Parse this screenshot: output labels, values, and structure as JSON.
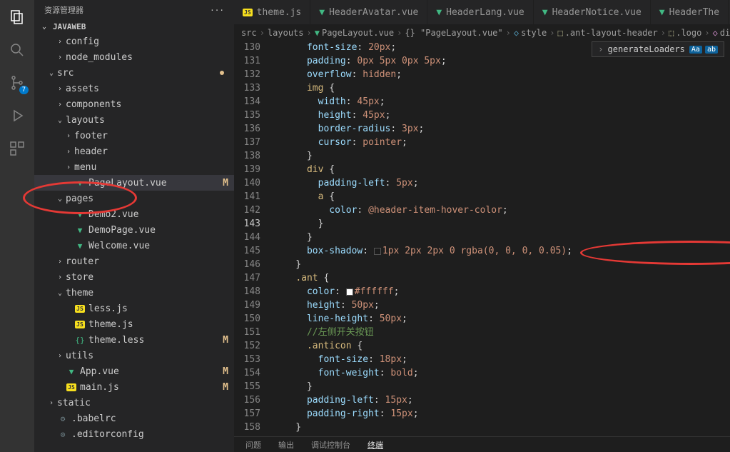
{
  "sidebar": {
    "title": "资源管理器",
    "project": "JAVAWEB",
    "badge": "7",
    "tree": [
      {
        "label": "config",
        "indent": 2,
        "chev": "›",
        "type": "folder"
      },
      {
        "label": "node_modules",
        "indent": 2,
        "chev": "›",
        "type": "folder"
      },
      {
        "label": "src",
        "indent": 1,
        "chev": "⌄",
        "type": "folder",
        "dot": true
      },
      {
        "label": "assets",
        "indent": 2,
        "chev": "›",
        "type": "folder"
      },
      {
        "label": "components",
        "indent": 2,
        "chev": "›",
        "type": "folder"
      },
      {
        "label": "layouts",
        "indent": 2,
        "chev": "⌄",
        "type": "folder"
      },
      {
        "label": "footer",
        "indent": 3,
        "chev": "›",
        "type": "folder"
      },
      {
        "label": "header",
        "indent": 3,
        "chev": "›",
        "type": "folder"
      },
      {
        "label": "menu",
        "indent": 3,
        "chev": "›",
        "type": "folder"
      },
      {
        "label": "PageLayout.vue",
        "indent": 3,
        "type": "vue",
        "selected": true,
        "status": "M"
      },
      {
        "label": "pages",
        "indent": 2,
        "chev": "⌄",
        "type": "folder"
      },
      {
        "label": "Demo2.vue",
        "indent": 3,
        "type": "vue"
      },
      {
        "label": "DemoPage.vue",
        "indent": 3,
        "type": "vue"
      },
      {
        "label": "Welcome.vue",
        "indent": 3,
        "type": "vue"
      },
      {
        "label": "router",
        "indent": 2,
        "chev": "›",
        "type": "folder"
      },
      {
        "label": "store",
        "indent": 2,
        "chev": "›",
        "type": "folder"
      },
      {
        "label": "theme",
        "indent": 2,
        "chev": "⌄",
        "type": "folder"
      },
      {
        "label": "less.js",
        "indent": 3,
        "type": "js"
      },
      {
        "label": "theme.js",
        "indent": 3,
        "type": "js"
      },
      {
        "label": "theme.less",
        "indent": 3,
        "type": "less",
        "status": "M"
      },
      {
        "label": "utils",
        "indent": 2,
        "chev": "›",
        "type": "folder"
      },
      {
        "label": "App.vue",
        "indent": 2,
        "type": "vue",
        "status": "M"
      },
      {
        "label": "main.js",
        "indent": 2,
        "type": "js",
        "status": "M"
      },
      {
        "label": "static",
        "indent": 1,
        "chev": "›",
        "type": "folder"
      },
      {
        "label": ".babelrc",
        "indent": 1,
        "type": "conf"
      },
      {
        "label": ".editorconfig",
        "indent": 1,
        "type": "conf"
      }
    ]
  },
  "tabs": [
    {
      "label": "theme.js",
      "type": "js"
    },
    {
      "label": "HeaderAvatar.vue",
      "type": "vue"
    },
    {
      "label": "HeaderLang.vue",
      "type": "vue"
    },
    {
      "label": "HeaderNotice.vue",
      "type": "vue"
    },
    {
      "label": "HeaderThe",
      "type": "vue"
    }
  ],
  "breadcrumbs": [
    "src",
    "layouts",
    "PageLayout.vue",
    "{} \"PageLayout.vue\"",
    "style",
    ".ant-layout-header",
    ".logo",
    "div"
  ],
  "symbol": "generateLoaders",
  "code": {
    "start": 130,
    "lines": [
      "      font-size: 20px;",
      "      padding: 0px 5px 0px 5px;",
      "      overflow: hidden;",
      "      img {",
      "        width: 45px;",
      "        height: 45px;",
      "        border-radius: 3px;",
      "        cursor: pointer;",
      "      }",
      "      div {",
      "        padding-left: 5px;",
      "        a {",
      "          color: @header-item-hover-color;",
      "        }",
      "      }",
      "      box-shadow: 1px 2px 2px 0 rgba(0, 0, 0, 0.05);",
      "    }",
      "    .ant {",
      "      color: #ffffff;",
      "      height: 50px;",
      "      line-height: 50px;",
      "      //左侧开关按钮",
      "      .anticon {",
      "        font-size: 18px;",
      "        font-weight: bold;",
      "      }",
      "      padding-left: 15px;",
      "      padding-right: 15px;",
      "    }"
    ]
  },
  "panel": [
    "问题",
    "输出",
    "调试控制台",
    "终端"
  ]
}
